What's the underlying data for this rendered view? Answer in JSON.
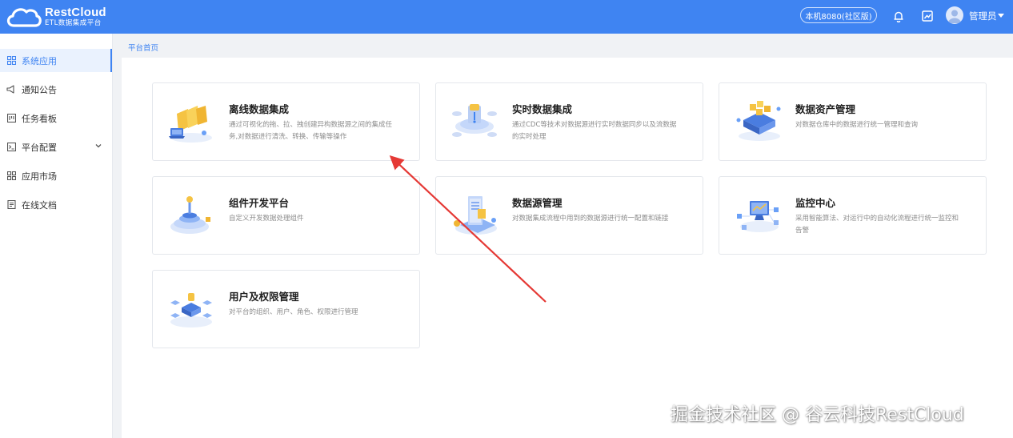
{
  "app": {
    "logo_name": "RestCloud",
    "logo_subtitle": "ETL数据集成平台",
    "environment": "本机8080(社区版)",
    "user_name": "管理员"
  },
  "sidebar": {
    "items": [
      {
        "label": "系统应用",
        "icon": "apps-grid-icon",
        "active": true
      },
      {
        "label": "通知公告",
        "icon": "megaphone-icon"
      },
      {
        "label": "任务看板",
        "icon": "board-icon"
      },
      {
        "label": "平台配置",
        "icon": "terminal-icon",
        "has_submenu": true
      },
      {
        "label": "应用市场",
        "icon": "apps-grid-icon"
      },
      {
        "label": "在线文档",
        "icon": "document-icon"
      }
    ]
  },
  "breadcrumb": "平台首页",
  "cards": [
    {
      "title": "离线数据集成",
      "desc": "通过可视化的拖、拉、拽创建异构数据源之间的集成任务,对数据进行清洗、转换、传输等操作",
      "icon": "offline-integration-icon"
    },
    {
      "title": "实时数据集成",
      "desc": "通过CDC等技术对数据源进行实时数据同步以及流数据的实时处理",
      "icon": "realtime-integration-icon"
    },
    {
      "title": "数据资产管理",
      "desc": "对数据仓库中的数据进行统一管理和查询",
      "icon": "data-asset-icon"
    },
    {
      "title": "组件开发平台",
      "desc": "自定义开发数据处理组件",
      "icon": "component-dev-icon"
    },
    {
      "title": "数据源管理",
      "desc": "对数据集成流程中用到的数据源进行统一配置和链接",
      "icon": "datasource-icon"
    },
    {
      "title": "监控中心",
      "desc": "采用智能算法、对运行中的自动化流程进行统一监控和告警",
      "icon": "monitor-icon"
    },
    {
      "title": "用户及权限管理",
      "desc": "对平台的组织、用户、角色、权限进行管理",
      "icon": "user-permission-icon"
    }
  ],
  "watermark": "掘金技术社区 @ 谷云科技RestCloud",
  "colors": {
    "brand": "#3f84f2",
    "annotation_arrow": "#e53935"
  }
}
